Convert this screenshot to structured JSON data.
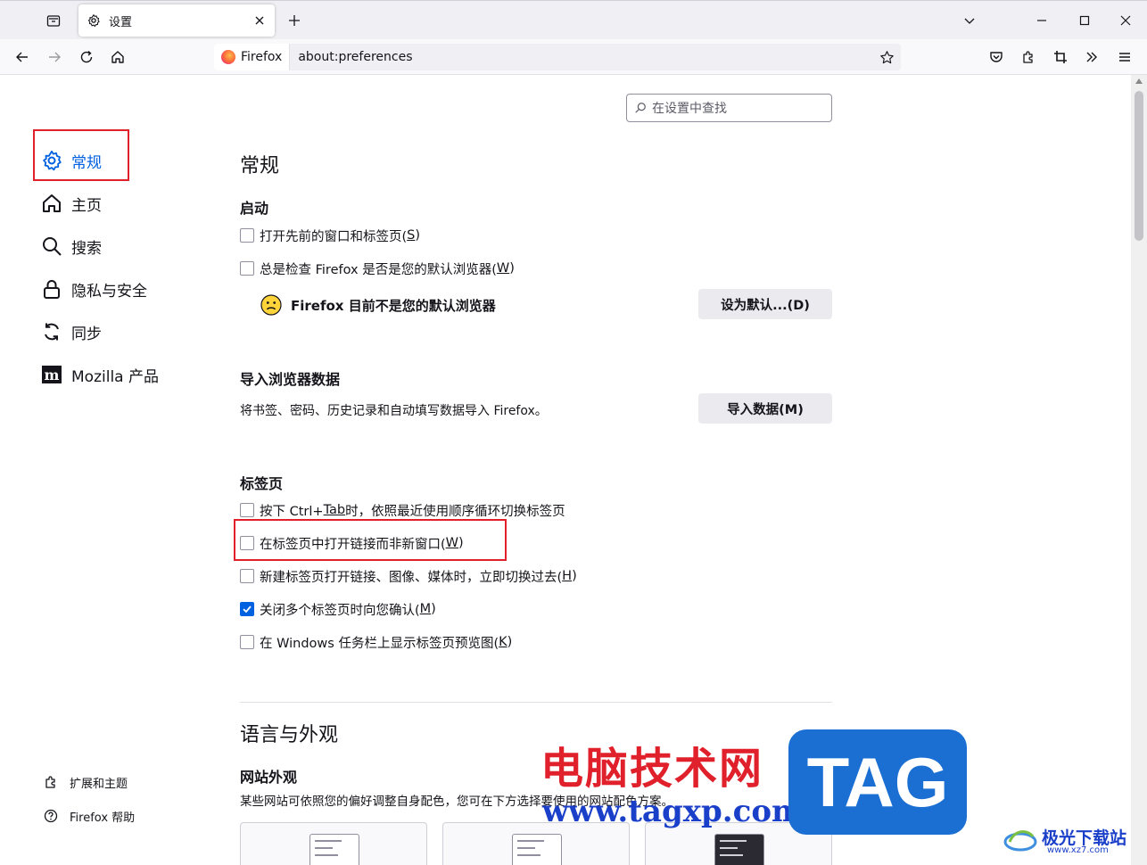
{
  "tab": {
    "title": "设置"
  },
  "urlbar": {
    "identity_label": "Firefox",
    "url": "about:preferences"
  },
  "search": {
    "placeholder": "在设置中查找"
  },
  "sidebar": {
    "items": [
      {
        "label": "常规",
        "icon": "gear-icon",
        "active": true
      },
      {
        "label": "主页",
        "icon": "home-icon"
      },
      {
        "label": "搜索",
        "icon": "search-icon"
      },
      {
        "label": "隐私与安全",
        "icon": "lock-icon"
      },
      {
        "label": "同步",
        "icon": "sync-icon"
      },
      {
        "label": "Mozilla 产品",
        "icon": "mozilla-icon"
      }
    ],
    "footer": [
      {
        "label": "扩展和主题",
        "icon": "puzzle-icon"
      },
      {
        "label": "Firefox 帮助",
        "icon": "help-icon"
      }
    ]
  },
  "main": {
    "title": "常规",
    "startup": {
      "heading": "启动",
      "restore_session": {
        "label": "打开先前的窗口和标签页(",
        "key": "S",
        "tail": ")",
        "checked": false
      },
      "check_default": {
        "label": "总是检查 Firefox 是否是您的默认浏览器(",
        "key": "W",
        "tail": ")",
        "checked": false
      },
      "not_default_text": "Firefox 目前不是您的默认浏览器",
      "set_default_button": "设为默认...(D)"
    },
    "import": {
      "heading": "导入浏览器数据",
      "description": "将书签、密码、历史记录和自动填写数据导入 Firefox。",
      "button": "导入数据(M)"
    },
    "tabs": {
      "heading": "标签页",
      "options": [
        {
          "label": "按下 Ctrl+",
          "key": "Tab",
          "tail": " 时，依照最近使用顺序循环切换标签页",
          "checked": false
        },
        {
          "label": "在标签页中打开链接而非新窗口(",
          "key": "W",
          "tail": ")",
          "checked": false
        },
        {
          "label": "新建标签页打开链接、图像、媒体时，立即切换过去(",
          "key": "H",
          "tail": ")",
          "checked": false
        },
        {
          "label": "关闭多个标签页时向您确认(",
          "key": "M",
          "tail": ")",
          "checked": true
        },
        {
          "label": "在 Windows 任务栏上显示标签页预览图(",
          "key": "K",
          "tail": ")",
          "checked": false
        }
      ]
    },
    "appearance": {
      "title": "语言与外观",
      "heading": "网站外观",
      "description": "某些网站可依照您的偏好调整自身配色，您可在下方选择要使用的网站配色方案。"
    }
  },
  "watermark": {
    "cn": "电脑技术网",
    "url": "www.tagxp.com",
    "tag": "TAG",
    "site": "极光下载站",
    "site_url": "www.xz7.com"
  },
  "colors": {
    "accent": "#0061e0",
    "highlight": "#e0202a"
  }
}
